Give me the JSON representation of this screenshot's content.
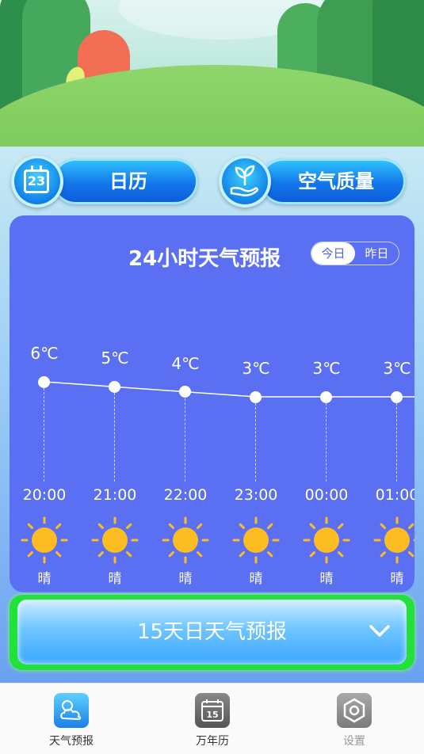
{
  "buttons": {
    "calendar_label": "日历",
    "calendar_icon_day": "23",
    "air_label": "空气质量"
  },
  "hourly_card": {
    "title": "24小时天气预报",
    "toggle_today": "今日",
    "toggle_yesterday": "昨日",
    "hours": [
      {
        "time": "20:00",
        "temp": "6℃",
        "temp_value": 6,
        "cond": "晴",
        "icon": "sun-icon"
      },
      {
        "time": "21:00",
        "temp": "5℃",
        "temp_value": 5,
        "cond": "晴",
        "icon": "sun-icon"
      },
      {
        "time": "22:00",
        "temp": "4℃",
        "temp_value": 4,
        "cond": "晴",
        "icon": "sun-icon"
      },
      {
        "time": "23:00",
        "temp": "3℃",
        "temp_value": 3,
        "cond": "晴",
        "icon": "sun-icon"
      },
      {
        "time": "00:00",
        "temp": "3℃",
        "temp_value": 3,
        "cond": "晴",
        "icon": "sun-icon"
      },
      {
        "time": "01:00",
        "temp": "3℃",
        "temp_value": 3,
        "cond": "晴",
        "icon": "sun-icon"
      }
    ]
  },
  "fifteen_day": {
    "label": "15天日天气预报",
    "icon": "chevron-down-icon"
  },
  "nav": {
    "items": [
      {
        "label": "天气预报",
        "icon": "weather-icon",
        "active": true
      },
      {
        "label": "万年历",
        "icon": "calendar-icon",
        "day": "15",
        "active": false
      },
      {
        "label": "设置",
        "icon": "settings-icon",
        "active": false
      }
    ]
  },
  "colors": {
    "card_bg": "#5b6ff2",
    "accent_green": "#22e23a",
    "sun": "#fbbd22"
  }
}
